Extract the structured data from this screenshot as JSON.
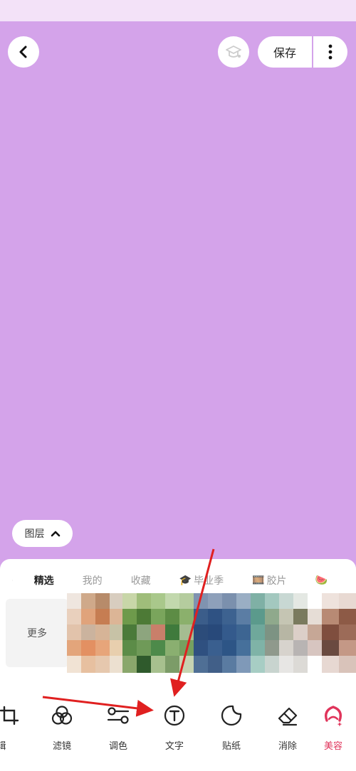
{
  "header": {
    "save_label": "保存"
  },
  "layer_button": {
    "label": "图层"
  },
  "sticker_categories": [
    {
      "label": "精选",
      "emoji": ""
    },
    {
      "label": "我的",
      "emoji": ""
    },
    {
      "label": "收藏",
      "emoji": ""
    },
    {
      "label": "毕业季",
      "emoji": "🎓"
    },
    {
      "label": "胶片",
      "emoji": "🎞️"
    },
    {
      "label": "",
      "emoji": "🍉"
    }
  ],
  "more_tile": {
    "label": "更多"
  },
  "toolbar": [
    {
      "label": "辑",
      "icon": "crop-icon"
    },
    {
      "label": "滤镜",
      "icon": "filter-icon"
    },
    {
      "label": "调色",
      "icon": "adjust-icon"
    },
    {
      "label": "文字",
      "icon": "text-icon"
    },
    {
      "label": "贴纸",
      "icon": "sticker-icon"
    },
    {
      "label": "消除",
      "icon": "eraser-icon"
    },
    {
      "label": "美容",
      "icon": "beauty-icon"
    }
  ],
  "colors": {
    "canvas": "#d4a3ea",
    "status_bar": "#f3e2f8",
    "accent": "#e0345b",
    "arrow": "#e02020"
  }
}
